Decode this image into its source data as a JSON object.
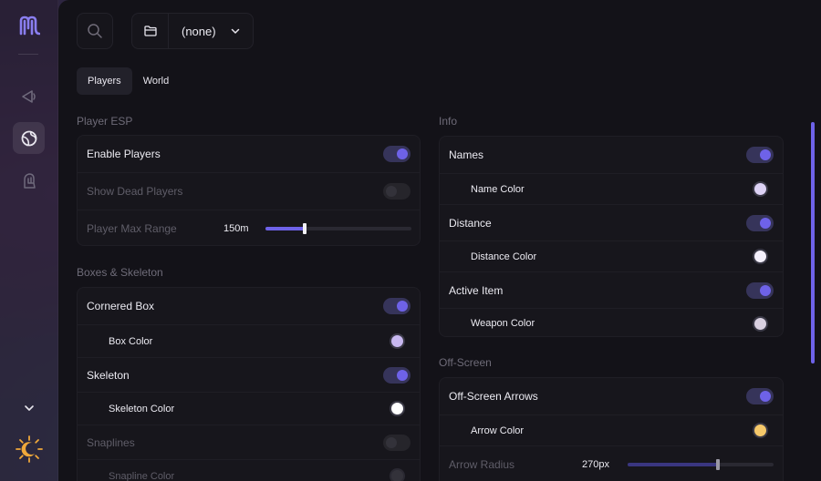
{
  "colors": {
    "accent": "#6e62e8",
    "background": "#131218",
    "card": "#17161c"
  },
  "rail": {
    "items": [
      {
        "name": "logo-icon"
      },
      {
        "name": "visuals-icon"
      },
      {
        "name": "globe-icon"
      },
      {
        "name": "hand-icon"
      },
      {
        "name": "chevron-down-icon"
      },
      {
        "name": "theme-sun-moon-icon"
      }
    ]
  },
  "header": {
    "search_icon": "search-icon",
    "profile": {
      "icon": "folder-icon",
      "value": "(none)"
    }
  },
  "tabs": [
    {
      "label": "Players",
      "active": true
    },
    {
      "label": "World",
      "active": false
    }
  ],
  "left": {
    "player_esp": {
      "title": "Player ESP",
      "enable_players": {
        "label": "Enable Players",
        "on": true
      },
      "show_dead": {
        "label": "Show Dead Players",
        "on": false
      },
      "max_range": {
        "label": "Player Max Range",
        "value": "150m",
        "fraction": 0.27
      }
    },
    "boxes": {
      "title": "Boxes & Skeleton",
      "cornered_box": {
        "label": "Cornered Box",
        "on": true
      },
      "box_color": {
        "label": "Box Color",
        "color": "#c8b8f0"
      },
      "skeleton": {
        "label": "Skeleton",
        "on": true
      },
      "skeleton_color": {
        "label": "Skeleton Color",
        "color": "#ffffff"
      },
      "snaplines": {
        "label": "Snaplines",
        "on": false
      },
      "snapline_color": {
        "label": "Snapline Color"
      }
    }
  },
  "right": {
    "info": {
      "title": "Info",
      "names": {
        "label": "Names",
        "on": true
      },
      "name_color": {
        "label": "Name Color",
        "color": "#ddd2f5"
      },
      "distance": {
        "label": "Distance",
        "on": true
      },
      "distance_color": {
        "label": "Distance Color",
        "color": "#f4f0fc"
      },
      "active_item": {
        "label": "Active Item",
        "on": true
      },
      "weapon_color": {
        "label": "Weapon Color",
        "color": "#d9d0e0"
      }
    },
    "offscreen": {
      "title": "Off-Screen",
      "arrows": {
        "label": "Off-Screen Arrows",
        "on": true
      },
      "arrow_color": {
        "label": "Arrow Color",
        "color": "#f5c86a"
      },
      "arrow_radius": {
        "label": "Arrow Radius",
        "value": "270px",
        "fraction": 0.62
      }
    }
  }
}
